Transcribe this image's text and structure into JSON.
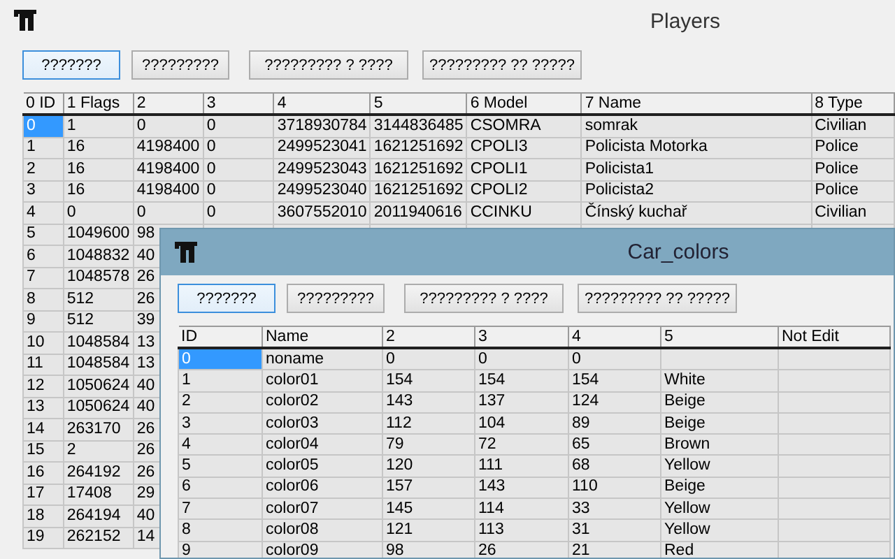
{
  "windows": [
    {
      "kind": "main",
      "title": "Players",
      "buttons": [
        {
          "label": "???????",
          "focused": true
        },
        {
          "label": "?????????",
          "focused": false
        },
        {
          "label": "????????? ? ????",
          "focused": false
        },
        {
          "label": "????????? ?? ?????",
          "focused": false
        }
      ],
      "table": {
        "columns": [
          "0 ID",
          "1 Flags",
          "2",
          "3",
          "4",
          "5",
          "6 Model",
          "7 Name",
          "8 Type"
        ],
        "rows": [
          {
            "selected": true,
            "cells": [
              "0",
              "1",
              "0",
              "0",
              "3718930784",
              "3144836485",
              "CSOMRA",
              "somrak",
              "Civilian"
            ]
          },
          {
            "selected": false,
            "cells": [
              "1",
              "16",
              "4198400",
              "0",
              "2499523041",
              "1621251692",
              "CPOLI3",
              "Policista Motorka",
              "Police"
            ]
          },
          {
            "selected": false,
            "cells": [
              "2",
              "16",
              "4198400",
              "0",
              "2499523043",
              "1621251692",
              "CPOLI1",
              "Policista1",
              "Police"
            ]
          },
          {
            "selected": false,
            "cells": [
              "3",
              "16",
              "4198400",
              "0",
              "2499523040",
              "1621251692",
              "CPOLI2",
              "Policista2",
              "Police"
            ]
          },
          {
            "selected": false,
            "cells": [
              "4",
              "0",
              "0",
              "0",
              "3607552010",
              "2011940616",
              "CCINKU",
              "Čínský kuchař",
              "Civilian"
            ]
          },
          {
            "selected": false,
            "cells": [
              "5",
              "1049600",
              "98"
            ]
          },
          {
            "selected": false,
            "cells": [
              "6",
              "1048832",
              "40"
            ]
          },
          {
            "selected": false,
            "cells": [
              "7",
              "1048578",
              "26"
            ]
          },
          {
            "selected": false,
            "cells": [
              "8",
              "512",
              "26"
            ]
          },
          {
            "selected": false,
            "cells": [
              "9",
              "512",
              "39"
            ]
          },
          {
            "selected": false,
            "cells": [
              "10",
              "1048584",
              "13"
            ]
          },
          {
            "selected": false,
            "cells": [
              "11",
              "1048584",
              "13"
            ]
          },
          {
            "selected": false,
            "cells": [
              "12",
              "1050624",
              "40"
            ]
          },
          {
            "selected": false,
            "cells": [
              "13",
              "1050624",
              "40"
            ]
          },
          {
            "selected": false,
            "cells": [
              "14",
              "263170",
              "26"
            ]
          },
          {
            "selected": false,
            "cells": [
              "15",
              "2",
              "26"
            ]
          },
          {
            "selected": false,
            "cells": [
              "16",
              "264192",
              "26"
            ]
          },
          {
            "selected": false,
            "cells": [
              "17",
              "17408",
              "29"
            ]
          },
          {
            "selected": false,
            "cells": [
              "18",
              "264194",
              "40"
            ]
          },
          {
            "selected": false,
            "cells": [
              "19",
              "262152",
              "14"
            ]
          }
        ]
      }
    },
    {
      "kind": "dialog",
      "title": "Car_colors",
      "buttons": [
        {
          "label": "???????",
          "focused": true
        },
        {
          "label": "?????????",
          "focused": false
        },
        {
          "label": "????????? ? ????",
          "focused": false
        },
        {
          "label": "????????? ?? ?????",
          "focused": false
        }
      ],
      "table": {
        "columns": [
          "ID",
          "Name",
          "2",
          "3",
          "4",
          "5",
          "Not Edit"
        ],
        "rows": [
          {
            "selected": true,
            "cells": [
              "0",
              "noname",
              "0",
              "0",
              "0"
            ]
          },
          {
            "selected": false,
            "cells": [
              "1",
              "color01",
              "154",
              "154",
              "154",
              "White"
            ]
          },
          {
            "selected": false,
            "cells": [
              "2",
              "color02",
              "143",
              "137",
              "124",
              "Beige"
            ]
          },
          {
            "selected": false,
            "cells": [
              "3",
              "color03",
              "112",
              "104",
              "89",
              "Beige"
            ]
          },
          {
            "selected": false,
            "cells": [
              "4",
              "color04",
              "79",
              "72",
              "65",
              "Brown"
            ]
          },
          {
            "selected": false,
            "cells": [
              "5",
              "color05",
              "120",
              "111",
              "68",
              "Yellow"
            ]
          },
          {
            "selected": false,
            "cells": [
              "6",
              "color06",
              "157",
              "143",
              "110",
              "Beige"
            ]
          },
          {
            "selected": false,
            "cells": [
              "7",
              "color07",
              "145",
              "114",
              "33",
              "Yellow"
            ]
          },
          {
            "selected": false,
            "cells": [
              "8",
              "color08",
              "121",
              "113",
              "31",
              "Yellow"
            ]
          },
          {
            "selected": false,
            "cells": [
              "9",
              "color09",
              "98",
              "26",
              "21",
              "Red"
            ]
          }
        ]
      }
    }
  ]
}
